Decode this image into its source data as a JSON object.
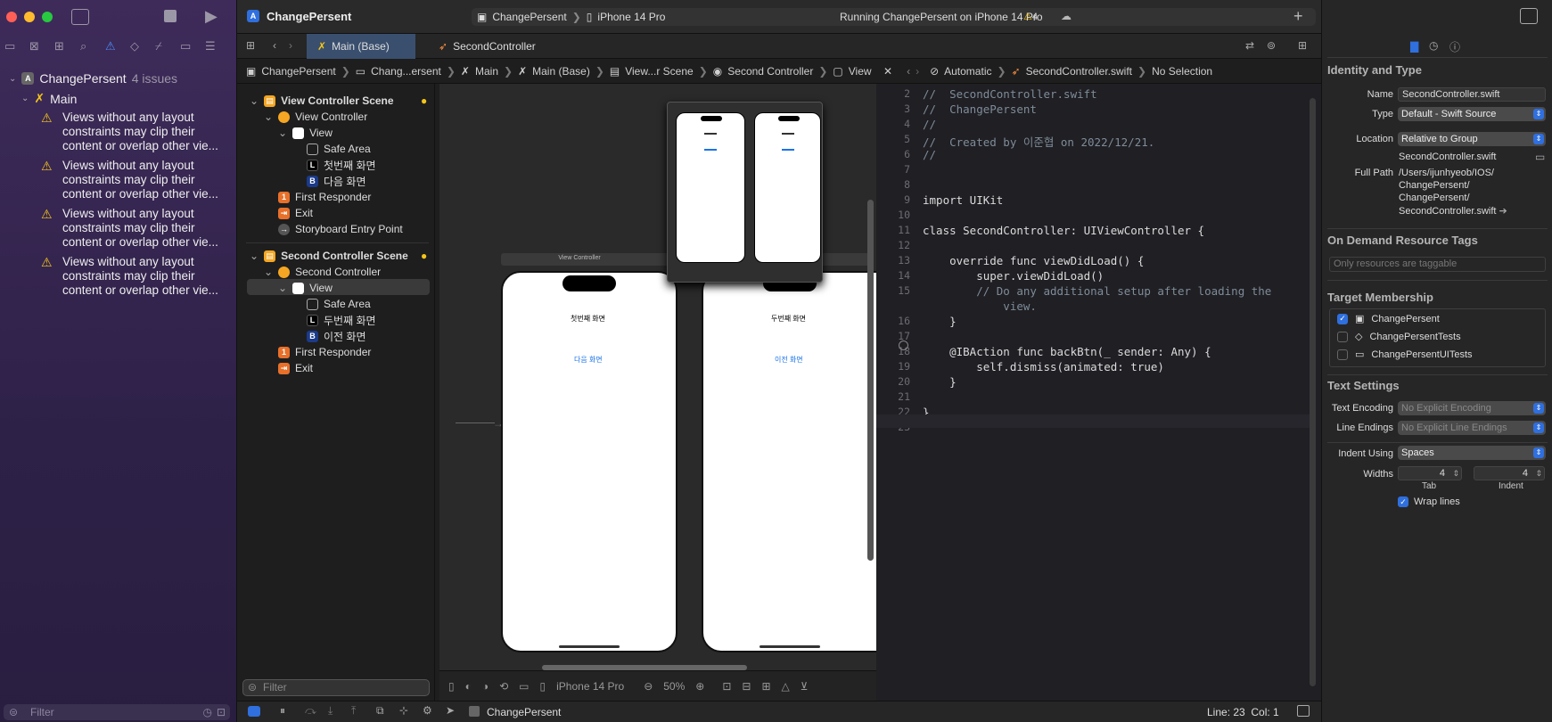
{
  "window": {
    "project_title": "ChangePersent"
  },
  "toolbar": {
    "scheme": "ChangePersent",
    "device": "iPhone 14 Pro",
    "status": "Running ChangePersent on iPhone 14 Pro",
    "warning_count": "4"
  },
  "issues": {
    "project": "ChangePersent",
    "count": "4 issues",
    "group": "Main",
    "items": [
      "Views without any layout constraints may clip their content or overlap other vie...",
      "Views without any layout constraints may clip their content or overlap other vie...",
      "Views without any layout constraints may clip their content or overlap other vie...",
      "Views without any layout constraints may clip their content or overlap other vie..."
    ]
  },
  "left_filter": {
    "placeholder": "Filter"
  },
  "tabs": [
    "Main (Base)",
    "SecondController"
  ],
  "jumpbar_left": [
    "ChangePersent",
    "Chang...ersent",
    "Main",
    "Main (Base)",
    "View...r Scene",
    "Second Controller",
    "View"
  ],
  "jumpbar_right": [
    "Automatic",
    "SecondController.swift",
    "No Selection"
  ],
  "outline": {
    "scene1": "View Controller Scene",
    "vc1": "View Controller",
    "view1": "View",
    "safe1": "Safe Area",
    "label1": "첫번째 화면",
    "button1": "다음 화면",
    "fr1": "First Responder",
    "exit1": "Exit",
    "entry": "Storyboard Entry Point",
    "scene2": "Second Controller Scene",
    "vc2": "Second Controller",
    "view2": "View",
    "safe2": "Safe Area",
    "label2": "두번째 화면",
    "button2": "이전 화면",
    "fr2": "First Responder",
    "exit2": "Exit",
    "filter_placeholder": "Filter"
  },
  "canvas": {
    "scene_title": "View Controller",
    "phone1_label": "첫번째 화면",
    "phone1_button": "다음 화면",
    "phone2_label": "두번째 화면",
    "phone2_button": "이전 화면"
  },
  "canvas_bar": {
    "device": "iPhone 14 Pro",
    "zoom": "50%"
  },
  "code": {
    "lines": [
      {
        "n": "2",
        "t": "//  SecondController.swift"
      },
      {
        "n": "3",
        "t": "//  ChangePersent"
      },
      {
        "n": "4",
        "t": "//"
      },
      {
        "n": "5",
        "t": "//  Created by 이준협 on 2022/12/21."
      },
      {
        "n": "6",
        "t": "//"
      },
      {
        "n": "7",
        "t": ""
      },
      {
        "n": "8",
        "t": ""
      },
      {
        "n": "9",
        "t": "import UIKit"
      },
      {
        "n": "10",
        "t": ""
      },
      {
        "n": "11",
        "t": "class SecondController: UIViewController {"
      },
      {
        "n": "12",
        "t": ""
      },
      {
        "n": "13",
        "t": "    override func viewDidLoad() {"
      },
      {
        "n": "14",
        "t": "        super.viewDidLoad()"
      },
      {
        "n": "15",
        "t": "        // Do any additional setup after loading the"
      },
      {
        "n": "",
        "t": "            view."
      },
      {
        "n": "16",
        "t": "    }"
      },
      {
        "n": "17",
        "t": ""
      },
      {
        "n": "18",
        "t": "    @IBAction func backBtn(_ sender: Any) {"
      },
      {
        "n": "19",
        "t": "        self.dismiss(animated: true)"
      },
      {
        "n": "20",
        "t": "    }"
      },
      {
        "n": "21",
        "t": ""
      },
      {
        "n": "22",
        "t": "}"
      },
      {
        "n": "23",
        "t": ""
      }
    ]
  },
  "status": {
    "scheme": "ChangePersent",
    "position": "Line: 23  Col: 1"
  },
  "inspector": {
    "identity_header": "Identity and Type",
    "name_label": "Name",
    "name_value": "SecondController.swift",
    "type_label": "Type",
    "type_value": "Default - Swift Source",
    "location_label": "Location",
    "location_value": "Relative to Group",
    "location_file": "SecondController.swift",
    "fullpath_label": "Full Path",
    "fullpath_lines": [
      "/Users/ijunhyeob/IOS/",
      "ChangePersent/",
      "ChangePersent/",
      "SecondController.swift"
    ],
    "odr_header": "On Demand Resource Tags",
    "odr_placeholder": "Only resources are taggable",
    "target_header": "Target Membership",
    "targets": [
      {
        "name": "ChangePersent",
        "checked": true
      },
      {
        "name": "ChangePersentTests",
        "checked": false
      },
      {
        "name": "ChangePersentUITests",
        "checked": false
      }
    ],
    "text_header": "Text Settings",
    "encoding_label": "Text Encoding",
    "encoding_value": "No Explicit Encoding",
    "endings_label": "Line Endings",
    "endings_value": "No Explicit Line Endings",
    "indent_label": "Indent Using",
    "indent_value": "Spaces",
    "widths_label": "Widths",
    "tab_value": "4",
    "indent_value_num": "4",
    "tab_caption": "Tab",
    "indent_caption": "Indent",
    "wrap_label": "Wrap lines"
  }
}
